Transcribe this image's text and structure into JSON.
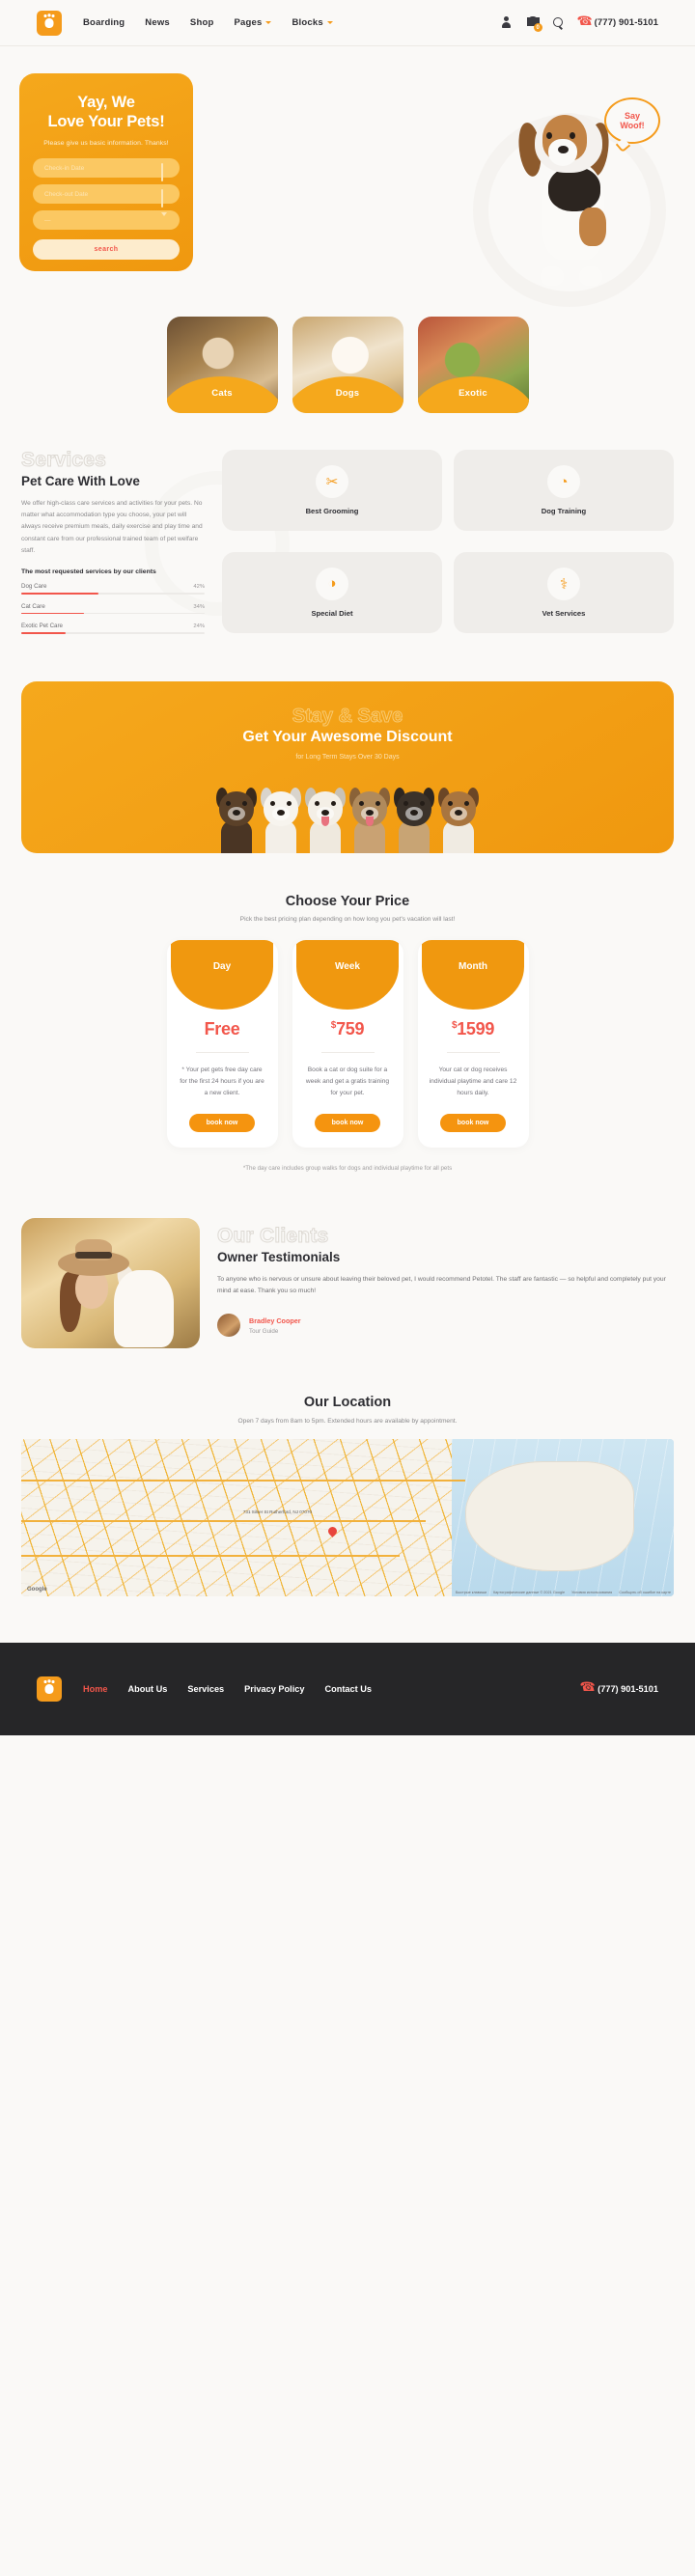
{
  "header": {
    "logo_icon": "home-paw-logo",
    "nav": [
      {
        "label": "Boarding",
        "caret": false
      },
      {
        "label": "News",
        "caret": false
      },
      {
        "label": "Shop",
        "caret": false
      },
      {
        "label": "Pages",
        "caret": true
      },
      {
        "label": "Blocks",
        "caret": true
      }
    ],
    "icons": [
      "user-icon",
      "cart-icon",
      "search-icon"
    ],
    "cart_count": "0",
    "phone": "(777) 901-5101"
  },
  "hero": {
    "title_line1": "Yay, We",
    "title_line2": "Love Your Pets!",
    "subtitle": "Please give us basic information. Thanks!",
    "field_checkin_placeholder": "Check-in Date",
    "field_checkout_placeholder": "Check-out Date",
    "field_select_placeholder": "—",
    "search_label": "search",
    "bubble_line1": "Say",
    "bubble_line2": "Woof!"
  },
  "categories": [
    {
      "label": "Cats",
      "image": "cat-photo"
    },
    {
      "label": "Dogs",
      "image": "dog-photo"
    },
    {
      "label": "Exotic",
      "image": "chameleon-photo"
    }
  ],
  "services": {
    "outline_title": "Services",
    "heading": "Pet Care With Love",
    "paragraph": "We offer high-class care services and activities for your pets. No matter what accommodation type you choose, your pet will always receive premium meals, daily exercise and play time and constant care from our professional trained team of pet welfare staff.",
    "bars_title": "The most requested services by our clients",
    "cards": [
      {
        "label": "Best Grooming",
        "icon": "scissors-icon",
        "glyph": "✂"
      },
      {
        "label": "Dog Training",
        "icon": "whistle-icon",
        "glyph": "◔"
      },
      {
        "label": "Special Diet",
        "icon": "dog-bowl-icon",
        "glyph": "◑"
      },
      {
        "label": "Vet Services",
        "icon": "stethoscope-icon",
        "glyph": "⚕"
      }
    ]
  },
  "discount": {
    "outline_title": "Stay & Save",
    "heading": "Get Your Awesome Discount",
    "subtitle": "for Long Term Stays Over 30 Days"
  },
  "pricing": {
    "heading": "Choose Your Price",
    "subtitle": "Pick the best pricing plan depending on how long you pet's vacation will last!",
    "plans": [
      {
        "name": "Day",
        "currency": "",
        "price": "Free",
        "description": "* Your pet gets free day care for the first 24 hours if you are a new client.",
        "button": "book now"
      },
      {
        "name": "Week",
        "currency": "$",
        "price": "759",
        "description": "Book a cat or dog suite for a week and get a gratis training for your pet.",
        "button": "book now"
      },
      {
        "name": "Month",
        "currency": "$",
        "price": "1599",
        "description": "Your cat or dog receives individual playtime and care 12 hours daily.",
        "button": "book now"
      }
    ],
    "note": "*The day care includes group walks for dogs and individual playtime for all pets"
  },
  "testimonials": {
    "outline_title": "Our Clients",
    "heading": "Owner Testimonials",
    "quote": "To anyone who is nervous or unsure about leaving their beloved pet, I would recommend Petotel. The staff are fantastic — so helpful and completely put your mind at ease. Thank you so much!",
    "author_name": "Bradley Cooper",
    "author_role": "Tour Guide"
  },
  "location": {
    "heading": "Our Location",
    "subtitle": "Open 7 days from 8am to 5pm. Extended hours are available by appointment.",
    "map_label": "731 Silver St Rutherford, NJ 07070",
    "map_logo": "Google",
    "map_attribution": [
      "Быстрые клавиши",
      "Картографические данные © 2021 Google",
      "Условия использования",
      "Сообщить об ошибке на карте"
    ]
  },
  "footer": {
    "logo_icon": "home-paw-logo",
    "nav": [
      {
        "label": "Home",
        "active": true
      },
      {
        "label": "About Us",
        "active": false
      },
      {
        "label": "Services",
        "active": false
      },
      {
        "label": "Privacy Policy",
        "active": false
      },
      {
        "label": "Contact Us",
        "active": false
      }
    ],
    "phone": "(777) 901-5101"
  },
  "colors": {
    "brand_orange": "#f59b1b",
    "deep_orange": "#f0980f",
    "accent_red": "#f2564b",
    "page_bg": "#faf9f7",
    "footer_bg": "#262628"
  },
  "chart_data": {
    "type": "bar",
    "title": "The most requested services by our clients",
    "orientation": "horizontal",
    "categories": [
      "Dog Care",
      "Cat Care",
      "Exotic Pet Care"
    ],
    "values": [
      42,
      34,
      24
    ],
    "unit": "%",
    "xlim": [
      0,
      100
    ],
    "grid": false,
    "legend": "none",
    "bar_color": "#f2564b",
    "track_color": "#eceae7"
  }
}
